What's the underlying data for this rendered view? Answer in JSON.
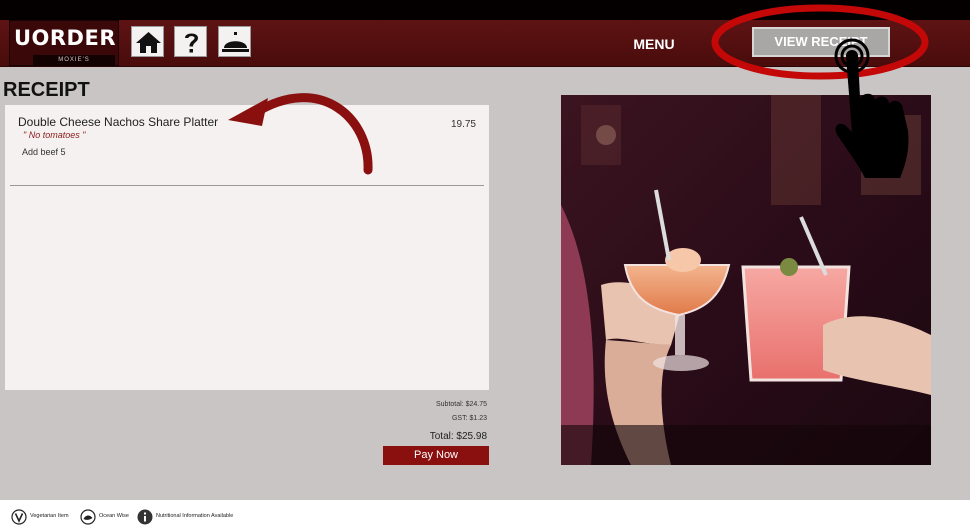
{
  "brand": {
    "logo_text": "UORDER",
    "logo_subtitle": "MOXIE'S"
  },
  "nav": {
    "icons": [
      "home-icon",
      "help-icon",
      "service-bell-icon"
    ],
    "menu_label": "MENU",
    "view_receipt_label": "VIEW RECEIPT"
  },
  "receipt": {
    "title": "RECEIPT",
    "items": [
      {
        "name": "Double Cheese Nachos Share Platter",
        "price": "19.75",
        "note": "\" No tomatoes \"",
        "addon": "Add beef 5"
      }
    ],
    "subtotal": "Subtotal: $24.75",
    "gst": "GST: $1.23",
    "total": "Total: $25.98",
    "pay_label": "Pay Now"
  },
  "footer": {
    "legend": [
      {
        "icon": "vegetarian-icon",
        "label": "Vegetarian Item"
      },
      {
        "icon": "ocean-wise-icon",
        "label": "Ocean Wise"
      },
      {
        "icon": "info-icon",
        "label": "Nutritional Information Available"
      }
    ]
  },
  "colors": {
    "header": "#5e1313",
    "accent": "#8a0f0f",
    "highlight": "#c40808",
    "background": "#c9c5c5",
    "panel": "#f4f1f0"
  }
}
